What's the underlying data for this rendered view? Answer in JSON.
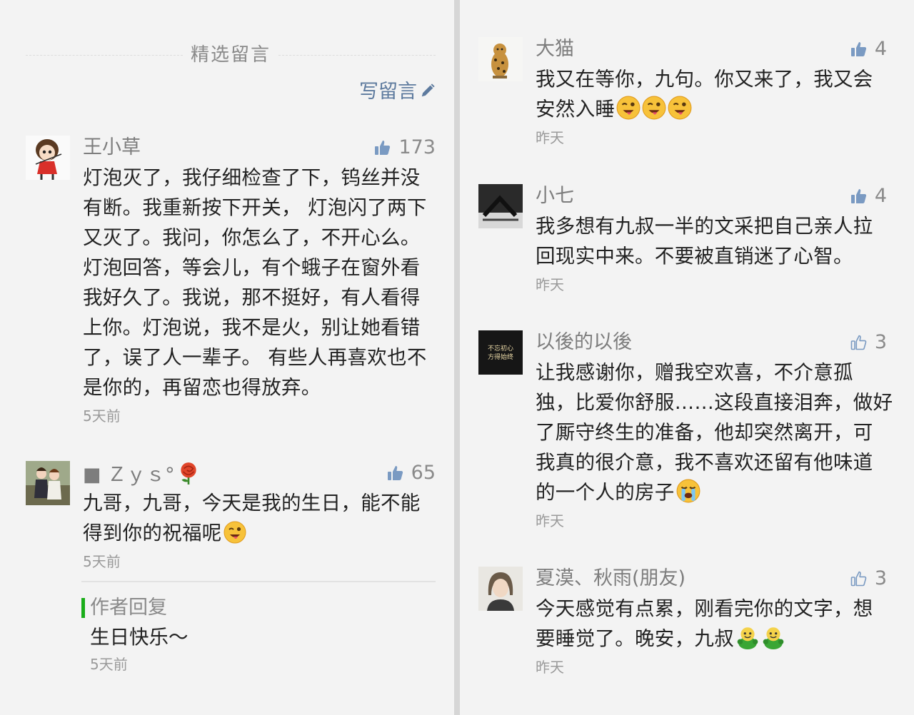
{
  "left": {
    "section_title": "精选留言",
    "write_label": "写留言",
    "comments": [
      {
        "name": "王小草",
        "likes": "173",
        "liked": true,
        "lines": [
          "灯泡灭了，我仔细检查了下，钨丝并没",
          "有断。我重新按下开关， 灯泡闪了两下",
          "又灭了。我问，你怎么了，不开心么。",
          "灯泡回答，等会儿，有个蛾子在窗外看",
          "我好久了。我说，那不挺好，有人看得",
          "上你。灯泡说，我不是火，别让她看错",
          "了，误了人一辈子。 有些人再喜欢也不",
          "是你的，再留恋也得放弃。"
        ],
        "time": "5天前"
      },
      {
        "name": "■ Ｚｙｓ°",
        "likes": "65",
        "liked": true,
        "lines": [
          "九哥，九哥，今天是我的生日，能不能",
          "得到你的祝福呢"
        ],
        "time": "5天前"
      }
    ],
    "reply": {
      "label": "作者回复",
      "text": "生日快乐～",
      "time": "5天前"
    }
  },
  "right": {
    "comments": [
      {
        "name": "大猫",
        "likes": "4",
        "liked": true,
        "lines": [
          "我又在等你，九句。你又来了，我又会",
          "安然入睡"
        ],
        "time": "昨天"
      },
      {
        "name": "小七",
        "likes": "4",
        "liked": true,
        "lines": [
          "我多想有九叔一半的文采把自己亲人拉",
          "回现实中来。不要被直销迷了心智。"
        ],
        "time": "昨天"
      },
      {
        "name": "以後的以後",
        "likes": "3",
        "liked": false,
        "avatar_text": [
          "不忘初心",
          "方得始终"
        ],
        "lines": [
          "让我感谢你，赠我空欢喜，不介意孤",
          "独，比爱你舒服……这段直接泪奔，做好",
          "了厮守终生的准备，他却突然离开，可",
          "我真的很介意，我不喜欢还留有他味道",
          "的一个人的房子"
        ],
        "time": "昨天"
      },
      {
        "name": "夏漠、秋雨(朋友)",
        "likes": "3",
        "liked": false,
        "lines": [
          "今天感觉有点累，刚看完你的文字，想",
          "要睡觉了。晚安，九叔"
        ],
        "time": "昨天"
      }
    ]
  },
  "colors": {
    "link": "#5d7a9e",
    "like_filled": "#7a9ac2",
    "reply_bar": "#1aad19",
    "text": "#222222",
    "muted": "#9a9a9a"
  },
  "icons": {
    "like_filled": "thumbs-up-filled-icon",
    "like_outline": "thumbs-up-outline-icon",
    "write": "pencil-icon"
  }
}
